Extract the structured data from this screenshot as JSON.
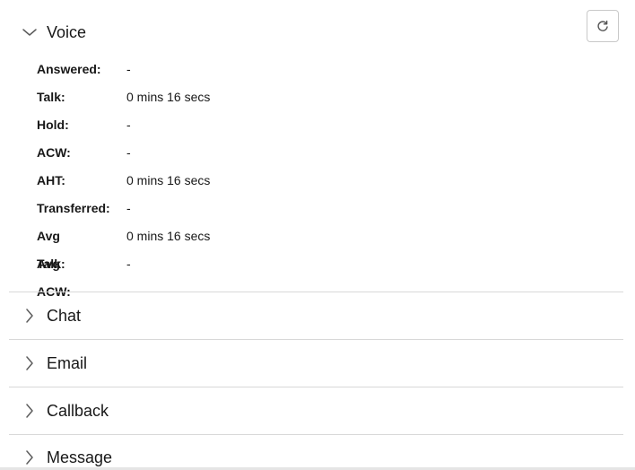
{
  "toolbar": {
    "refresh_icon": "refresh-icon"
  },
  "voice": {
    "title": "Voice",
    "expanded": true,
    "stats": [
      {
        "label": "Answered:",
        "value": "-"
      },
      {
        "label": "Talk:",
        "value": "0 mins 16 secs"
      },
      {
        "label": "Hold:",
        "value": "-"
      },
      {
        "label": "ACW:",
        "value": "-"
      },
      {
        "label": "AHT:",
        "value": "0 mins 16 secs"
      },
      {
        "label": "Transferred:",
        "value": "-"
      },
      {
        "label": "Avg Talk:",
        "value": "0 mins 16 secs"
      },
      {
        "label": "Avg ACW:",
        "value": "-"
      }
    ]
  },
  "sections": [
    {
      "title": "Chat",
      "expanded": false
    },
    {
      "title": "Email",
      "expanded": false
    },
    {
      "title": "Callback",
      "expanded": false
    },
    {
      "title": "Message",
      "expanded": false
    }
  ]
}
